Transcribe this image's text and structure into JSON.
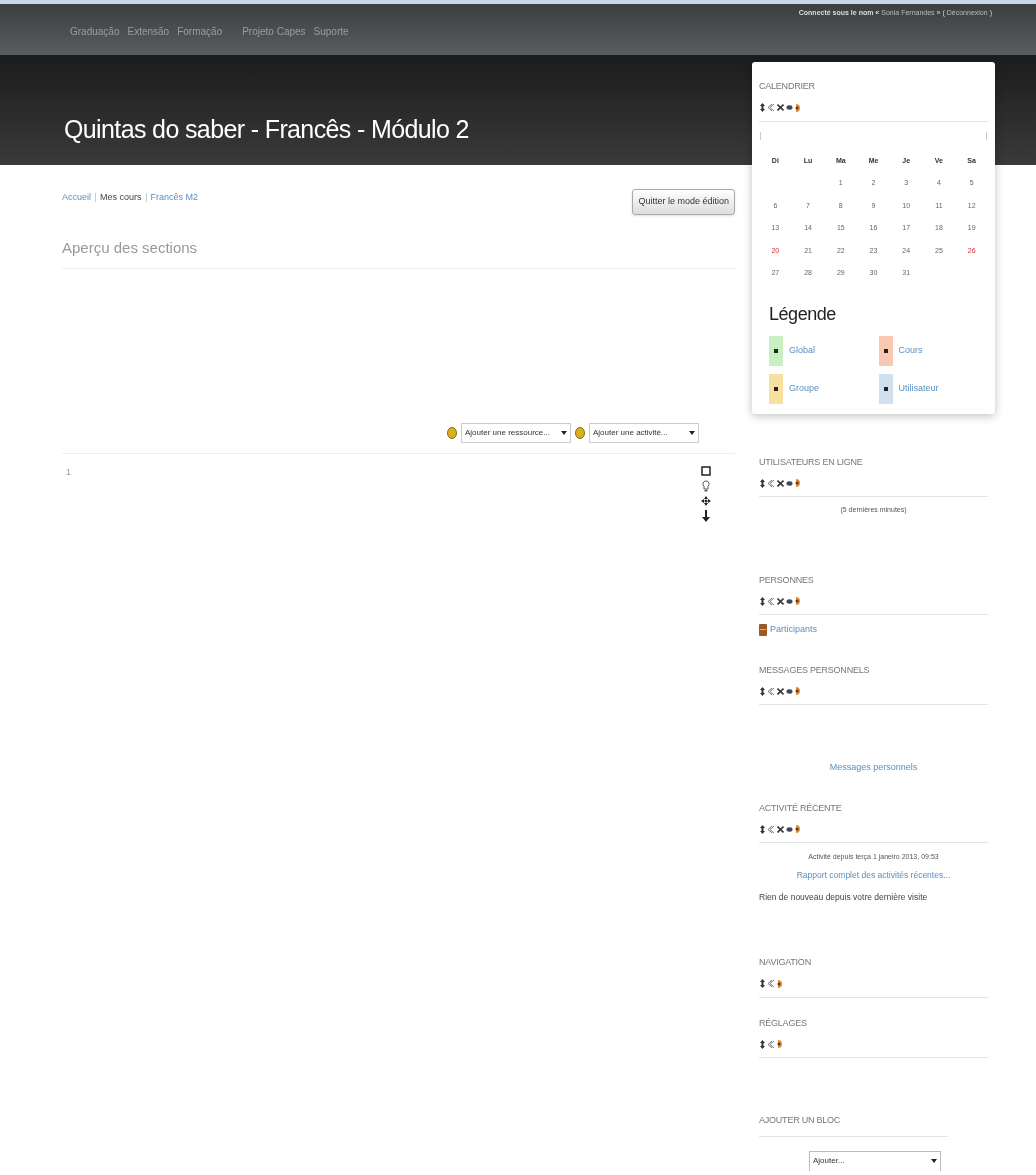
{
  "top_bar": {
    "nav": [
      "Graduação",
      "Extensão",
      "Formação",
      "Projeto Capes",
      "Suporte"
    ],
    "login_info": {
      "prefix": "Connecté sous le nom «",
      "user": "Sonia Fernandes",
      "middle": "» (",
      "logout": "Déconnexion",
      "suffix": ")"
    }
  },
  "header": {
    "title": "Quintas do saber - Francês - Módulo 2"
  },
  "breadcrumb": [
    {
      "label": "Accueil",
      "link": true
    },
    {
      "label": "Mes cours",
      "link": false
    },
    {
      "label": "Francês M2",
      "link": true
    }
  ],
  "edit_button": "Quitter le mode édition",
  "section_heading": "Aperçu des sections",
  "add_menus": [
    {
      "value": "Ajouter une ressource..."
    },
    {
      "value": "Ajouter une activité..."
    }
  ],
  "section": {
    "number": "1",
    "controls": [
      {
        "kind": "highlight"
      },
      {
        "kind": "visible"
      },
      {
        "kind": "move"
      },
      {
        "kind": "down"
      }
    ]
  },
  "blocks": [
    {
      "kind": "calendar",
      "title": "CALENDRIER",
      "controls": [
        {
          "kind": "move"
        },
        {
          "kind": "collapse"
        },
        {
          "kind": "delete"
        },
        {
          "kind": "hide"
        },
        {
          "kind": "roles"
        }
      ],
      "weekdays": [
        "Di",
        "Lu",
        "Ma",
        "Me",
        "Je",
        "Ve",
        "Sa"
      ],
      "weeks": [
        {
          "right_aligned": true,
          "days": [
            {
              "day": "1",
              "marked": false
            },
            {
              "day": "2",
              "marked": false
            },
            {
              "day": "3",
              "marked": false
            },
            {
              "day": "4",
              "marked": false
            },
            {
              "day": "5",
              "marked": false
            }
          ]
        },
        {
          "days": [
            {
              "day": "6",
              "marked": false
            },
            {
              "day": "7",
              "marked": false
            },
            {
              "day": "8",
              "marked": false
            },
            {
              "day": "9",
              "marked": false
            },
            {
              "day": "10",
              "marked": false
            },
            {
              "day": "11",
              "marked": false
            },
            {
              "day": "12",
              "marked": false
            }
          ]
        },
        {
          "days": [
            {
              "day": "13",
              "marked": false
            },
            {
              "day": "14",
              "marked": false
            },
            {
              "day": "15",
              "marked": false
            },
            {
              "day": "16",
              "marked": false
            },
            {
              "day": "17",
              "marked": false
            },
            {
              "day": "18",
              "marked": false
            },
            {
              "day": "19",
              "marked": false
            }
          ]
        },
        {
          "days": [
            {
              "day": "20",
              "marked": true
            },
            {
              "day": "21",
              "marked": false
            },
            {
              "day": "22",
              "marked": false
            },
            {
              "day": "23",
              "marked": false
            },
            {
              "day": "24",
              "marked": false
            },
            {
              "day": "25",
              "marked": false
            },
            {
              "day": "26",
              "marked": true
            }
          ]
        },
        {
          "right_aligned": false,
          "days": [
            {
              "day": "27",
              "marked": false
            },
            {
              "day": "28",
              "marked": false
            },
            {
              "day": "29",
              "marked": false
            },
            {
              "day": "30",
              "marked": false
            },
            {
              "day": "31",
              "marked": false
            }
          ]
        }
      ],
      "legend_title": "Légende",
      "legend": [
        {
          "label": "Global",
          "color": "#c8f0c0"
        },
        {
          "label": "Cours",
          "color": "#f8c8b0"
        },
        {
          "label": "Groupe",
          "color": "#f8e0a0"
        },
        {
          "label": "Utilisateur",
          "color": "#d0e0f0"
        }
      ]
    },
    {
      "kind": "online",
      "title": "UTILISATEURS EN LIGNE",
      "controls": [
        {
          "kind": "move"
        },
        {
          "kind": "collapse"
        },
        {
          "kind": "delete"
        },
        {
          "kind": "hide"
        },
        {
          "kind": "roles"
        }
      ],
      "note": "(5 dernières minutes)"
    },
    {
      "kind": "people",
      "title": "PERSONNES",
      "controls": [
        {
          "kind": "move"
        },
        {
          "kind": "collapse"
        },
        {
          "kind": "delete"
        },
        {
          "kind": "hide"
        },
        {
          "kind": "roles"
        }
      ],
      "link": "Participants"
    },
    {
      "kind": "messages",
      "title": "MESSAGES PERSONNELS",
      "controls": [
        {
          "kind": "move"
        },
        {
          "kind": "collapse"
        },
        {
          "kind": "delete"
        },
        {
          "kind": "hide"
        },
        {
          "kind": "roles"
        }
      ],
      "link": "Messages personnels"
    },
    {
      "kind": "activity",
      "title": "ACTIVITÉ RÉCENTE",
      "controls": [
        {
          "kind": "move"
        },
        {
          "kind": "collapse"
        },
        {
          "kind": "delete"
        },
        {
          "kind": "hide"
        },
        {
          "kind": "roles"
        }
      ],
      "since": "Activité depuis terça 1 janeiro 2013, 09:53",
      "link": "Rapport complet des activités récentes...",
      "empty": "Rien de nouveau depuis votre dernière visite"
    },
    {
      "kind": "plain",
      "title": "NAVIGATION",
      "controls": [
        {
          "kind": "move"
        },
        {
          "kind": "collapse"
        },
        {
          "kind": "roles"
        }
      ]
    },
    {
      "kind": "plain",
      "title": "RÉGLAGES",
      "controls": [
        {
          "kind": "move"
        },
        {
          "kind": "collapse"
        },
        {
          "kind": "roles"
        }
      ]
    },
    {
      "kind": "add",
      "title": "AJOUTER UN BLOC",
      "select": "Ajouter..."
    }
  ]
}
